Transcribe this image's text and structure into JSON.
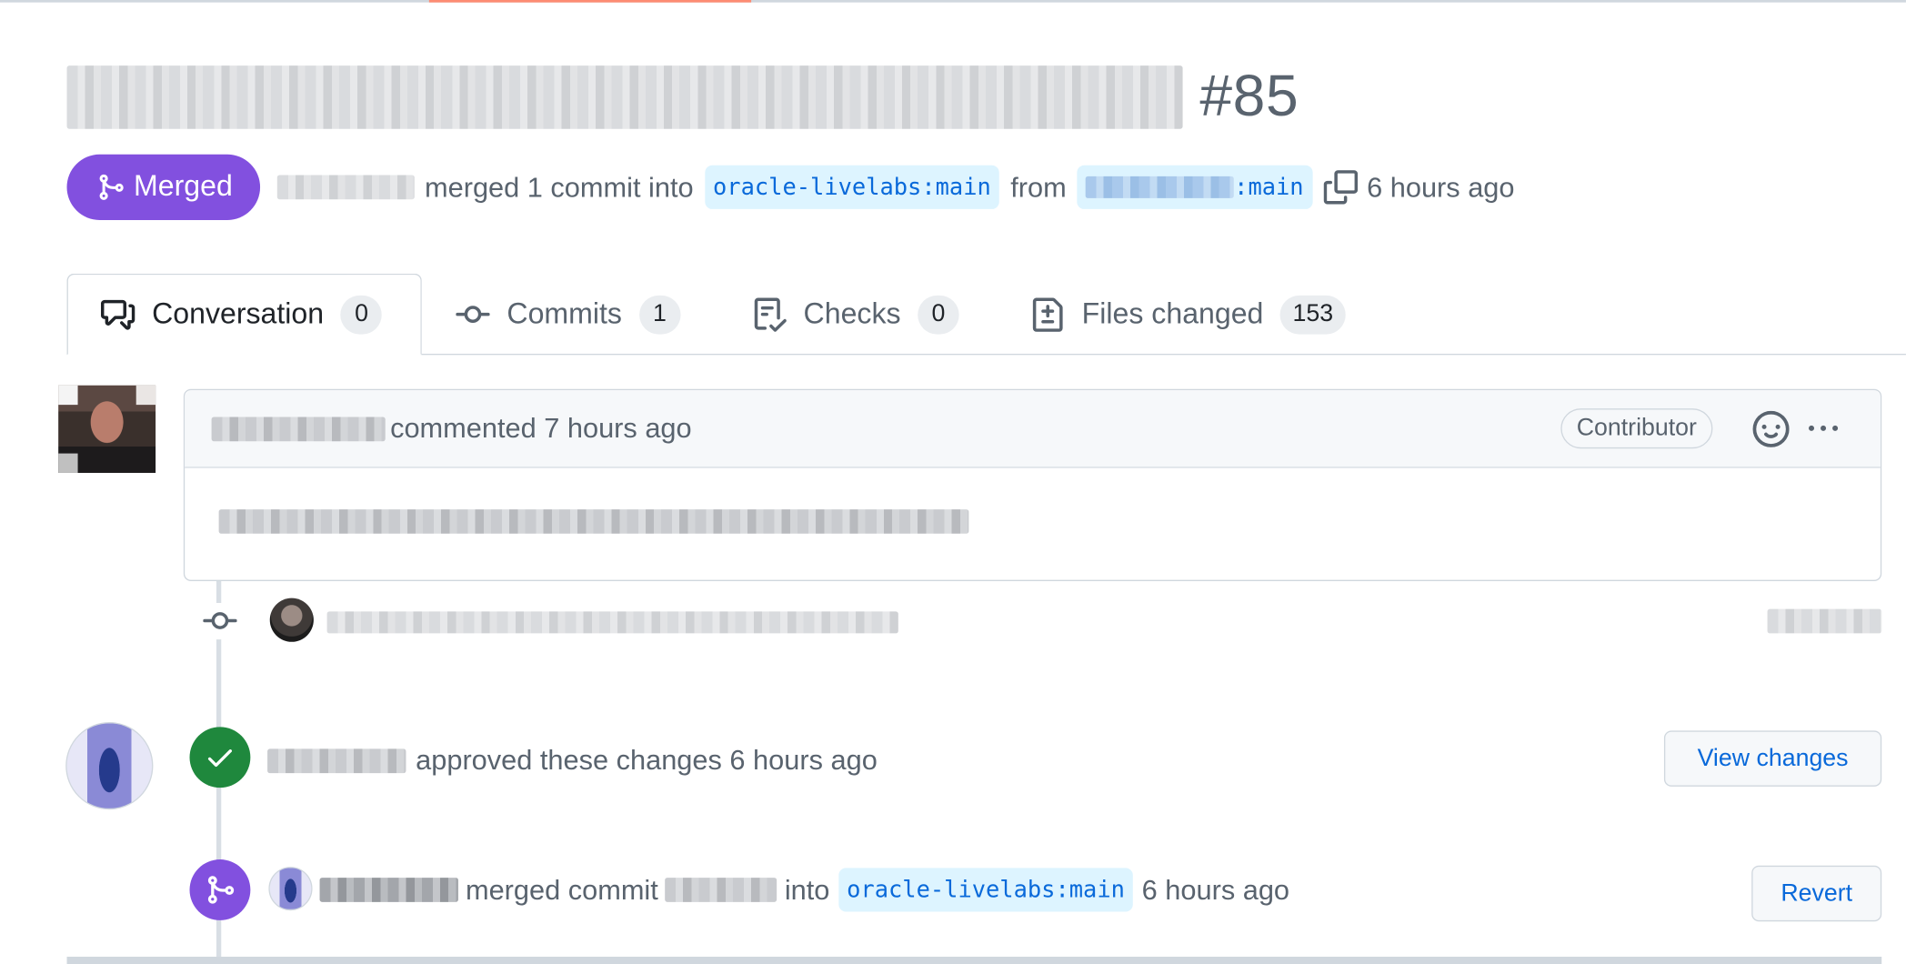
{
  "pr": {
    "title_redacted": "",
    "number": "#85",
    "state": "Merged",
    "merger_redacted": "",
    "merge_text": "merged 1 commit into",
    "base_branch": "oracle-livelabs:main",
    "from_text": "from",
    "head_branch_suffix": ":main",
    "time_ago": "6 hours ago"
  },
  "tabs": [
    {
      "label": "Conversation",
      "count": "0"
    },
    {
      "label": "Commits",
      "count": "1"
    },
    {
      "label": "Checks",
      "count": "0"
    },
    {
      "label": "Files changed",
      "count": "153"
    }
  ],
  "comment": {
    "action": "commented 7 hours ago",
    "badge": "Contributor",
    "body_redacted": ""
  },
  "timeline": {
    "commit_message_redacted": "",
    "review_text": "approved these changes 6 hours ago",
    "view_changes_label": "View changes",
    "merge_event": {
      "merged_commit_text": "merged commit",
      "into_text": "into",
      "branch": "oracle-livelabs:main",
      "time_ago": "6 hours ago"
    },
    "revert_label": "Revert"
  },
  "colors": {
    "merged_purple": "#8250df",
    "approved_green": "#1f883d",
    "link_blue": "#0969da",
    "branch_bg": "#ddf4ff",
    "tab_accent": "#fd8c73"
  },
  "icons": {
    "state": "git-merge-icon",
    "copy": "copy-icon",
    "conversation": "comment-discussion-icon",
    "commits": "git-commit-icon",
    "checks": "checklist-icon",
    "files": "file-diff-icon",
    "reaction": "smiley-icon",
    "menu": "kebab-horizontal-icon",
    "approved": "check-icon"
  }
}
